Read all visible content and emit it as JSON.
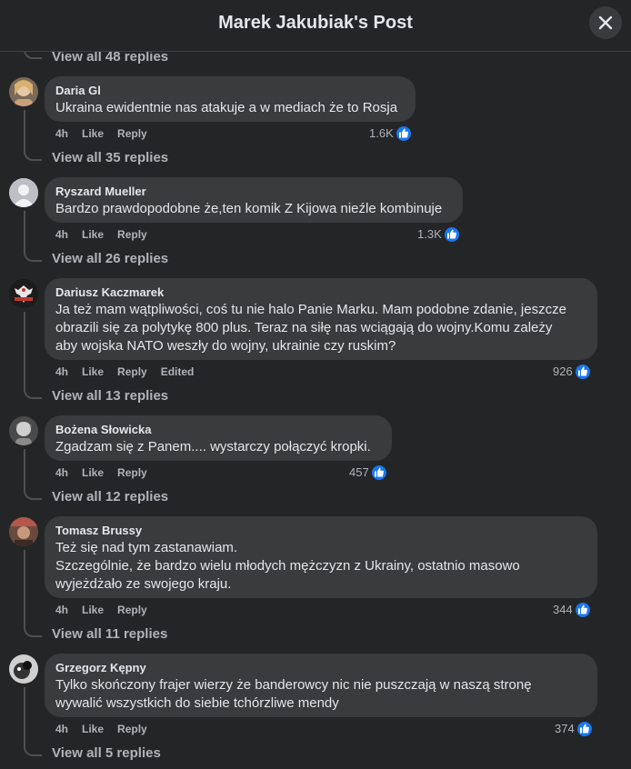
{
  "header": {
    "title": "Marek Jakubiak's Post"
  },
  "top_view_replies": "View all 48 replies",
  "actions": {
    "like": "Like",
    "reply": "Reply"
  },
  "comments": [
    {
      "author": "Daria Gl",
      "text": "Ukraina ewidentnie nas atakuje a w mediach że to Rosja",
      "time": "4h",
      "reactions": "1.6K",
      "edited": "",
      "view_replies": "View all 35 replies",
      "avatar_color": "#c9a27a"
    },
    {
      "author": "Ryszard Mueller",
      "text": "Bardzo prawdopodobne że,ten komik Z Kijowa nieźle kombinuje",
      "time": "4h",
      "reactions": "1.3K",
      "edited": "",
      "view_replies": "View all 26 replies",
      "avatar_color": "#bcc0c4"
    },
    {
      "author": "Dariusz Kaczmarek",
      "text": "Ja też mam wątpliwości, coś tu nie halo Panie Marku. Mam podobne zdanie, jeszcze\nobrazili się za polytykę 800 plus. Teraz na siłę nas wciągają do wojny.Komu zależy\naby wojska NATO weszły do wojny, ukrainie czy ruskim?",
      "time": "4h",
      "reactions": "926",
      "edited": "Edited",
      "view_replies": "View all 13 replies",
      "avatar_color": "#2a2a2a"
    },
    {
      "author": "Bożena Słowicka",
      "text": "Zgadzam się z Panem.... wystarczy połączyć kropki.",
      "time": "4h",
      "reactions": "457",
      "edited": "",
      "view_replies": "View all 12 replies",
      "avatar_color": "#9a9a9a"
    },
    {
      "author": "Tomasz Brussy",
      "text": "Też się nad tym zastanawiam.\nSzczególnie, że bardzo wielu młodych mężczyzn z Ukrainy, ostatnio masowo\nwyjeżdżało ze swojego kraju.",
      "time": "4h",
      "reactions": "344",
      "edited": "",
      "view_replies": "View all 11 replies",
      "avatar_color": "#8a5a4a"
    },
    {
      "author": "Grzegorz Kępny",
      "text": "Tylko skończony frajer wierzy że banderowcy nic nie puszczają w naszą stronę\nwywalić wszystkich do siebie tchórzliwe mendy",
      "time": "4h",
      "reactions": "374",
      "edited": "",
      "view_replies": "View all 5 replies",
      "avatar_color": "#d8d8d8"
    }
  ]
}
